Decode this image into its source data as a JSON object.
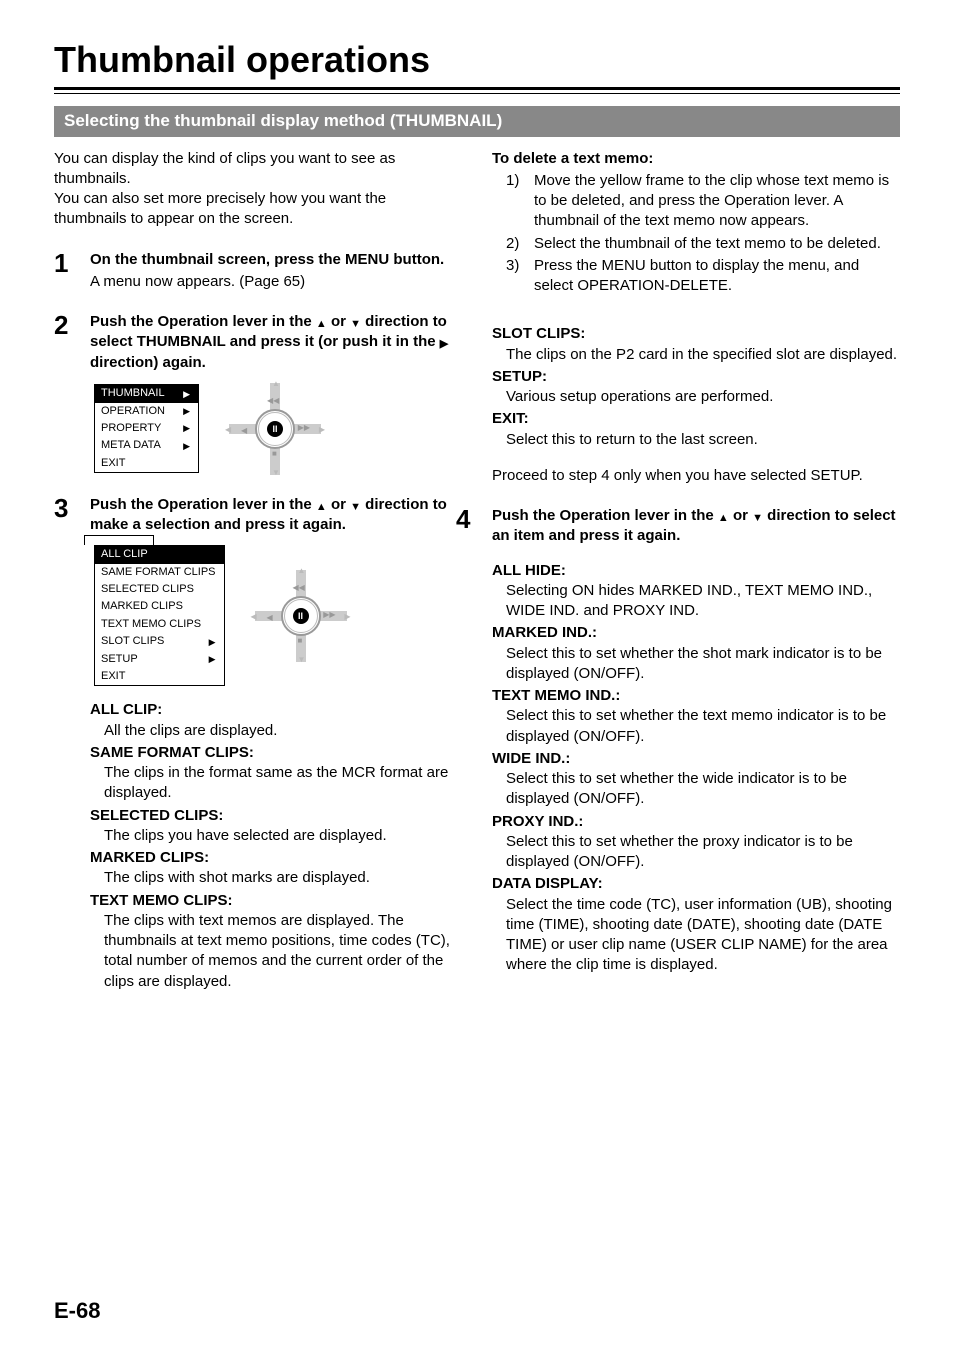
{
  "page_title": "Thumbnail operations",
  "section_bar": "Selecting the thumbnail display method (THUMBNAIL)",
  "page_number": "E-68",
  "intro": {
    "p1": "You can display the kind of clips you want to see as thumbnails.",
    "p2": "You can also set more precisely how you want the thumbnails to appear on the screen."
  },
  "step1": {
    "num": "1",
    "bold": "On the thumbnail screen, press the MENU button.",
    "body": "A menu now appears. (Page 65)"
  },
  "step2": {
    "num": "2",
    "bold_pre": "Push the Operation lever in the ",
    "bold_mid": " or ",
    "bold_post1": " direction to select THUMBNAIL and press it (or push it in the ",
    "bold_post2": " direction) again.",
    "menu": [
      "THUMBNAIL",
      "OPERATION",
      "PROPERTY",
      "META DATA",
      "EXIT"
    ],
    "menu_arrow_indices": [
      0,
      1,
      2,
      3
    ]
  },
  "step3": {
    "num": "3",
    "bold_pre": "Push the Operation lever in the ",
    "bold_mid": " or ",
    "bold_post": " direction to make a selection and press it again.",
    "menu": [
      "ALL CLIP",
      "SAME FORMAT CLIPS",
      "SELECTED CLIPS",
      "MARKED CLIPS",
      "TEXT MEMO CLIPS",
      "SLOT CLIPS",
      "SETUP",
      "EXIT"
    ],
    "menu_arrow_indices": [
      5,
      6
    ]
  },
  "defs_left": [
    {
      "t": "ALL CLIP:",
      "d": "All the clips are displayed."
    },
    {
      "t": "SAME FORMAT CLIPS:",
      "d": "The clips in the format same as the MCR format are displayed."
    },
    {
      "t": "SELECTED CLIPS:",
      "d": "The clips you have selected are displayed."
    },
    {
      "t": "MARKED CLIPS:",
      "d": "The clips with shot marks are displayed."
    },
    {
      "t": "TEXT MEMO CLIPS:",
      "d": "The clips with text memos are displayed. The thumbnails at text memo positions, time codes (TC), total number of memos and the current order of the clips are displayed."
    }
  ],
  "right": {
    "delete_head": "To delete a text memo:",
    "delete_steps": [
      {
        "n": "1)",
        "t": "Move the yellow frame to the clip whose text memo is to be deleted, and press the Operation lever. A thumbnail of the text memo now appears."
      },
      {
        "n": "2)",
        "t": "Select the thumbnail of the text memo to be deleted."
      },
      {
        "n": "3)",
        "t": "Press the MENU button to display the menu, and select OPERATION-DELETE."
      }
    ],
    "defs1": [
      {
        "t": "SLOT CLIPS:",
        "d": "The clips on the P2 card in the specified slot are displayed."
      },
      {
        "t": "SETUP:",
        "d": "Various setup operations are performed."
      },
      {
        "t": "EXIT:",
        "d": "Select this to return to the last screen."
      }
    ],
    "proceed": "Proceed to step 4 only when you have selected SETUP.",
    "step4": {
      "num": "4",
      "bold_pre": "Push the Operation lever in the ",
      "bold_mid": " or ",
      "bold_post": " direction to select an item and press it again."
    },
    "defs2": [
      {
        "t": "ALL HIDE:",
        "d": "Selecting ON hides MARKED IND., TEXT MEMO IND., WIDE IND. and PROXY IND."
      },
      {
        "t": "MARKED IND.:",
        "d": "Select this to set whether the shot mark indicator is to be displayed (ON/OFF)."
      },
      {
        "t": "TEXT MEMO IND.:",
        "d": "Select this to set whether the text memo indicator is to be displayed (ON/OFF)."
      },
      {
        "t": "WIDE IND.:",
        "d": "Select this to set whether the wide indicator is to be displayed (ON/OFF)."
      },
      {
        "t": "PROXY IND.:",
        "d": "Select this to set whether the proxy indicator is to be displayed (ON/OFF)."
      },
      {
        "t": "DATA DISPLAY:",
        "d": "Select the time code (TC), user information (UB), shooting time (TIME), shooting date (DATE), shooting date (DATE TIME) or user clip name (USER CLIP NAME) for the area where the clip time is displayed."
      }
    ]
  }
}
